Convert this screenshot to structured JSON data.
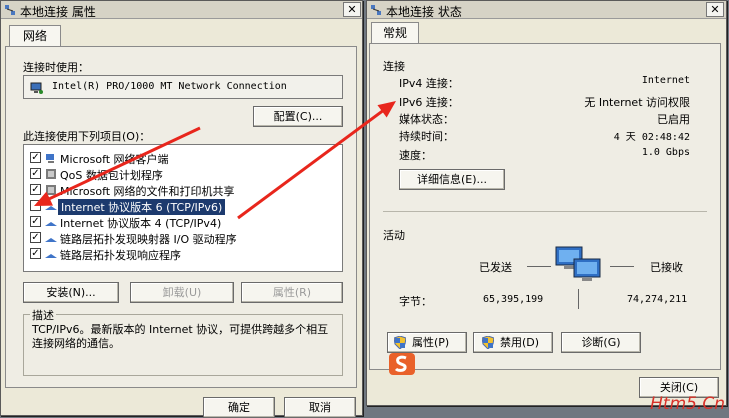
{
  "left_window": {
    "title": "本地连接 属性",
    "close_glyph": "✕",
    "tab": "网络",
    "connect_using_label": "连接时使用：",
    "adapter_name": "Intel(R) PRO/1000 MT Network Connection",
    "configure_button": "配置(C)...",
    "items_label": "此连接使用下列项目(O)：",
    "items": [
      {
        "label": "Microsoft 网络客户端",
        "checked": true
      },
      {
        "label": "QoS 数据包计划程序",
        "checked": true
      },
      {
        "label": "Microsoft 网络的文件和打印机共享",
        "checked": true
      },
      {
        "label": "Internet 协议版本 6 (TCP/IPv6)",
        "checked": false
      },
      {
        "label": "Internet 协议版本 4 (TCP/IPv4)",
        "checked": true
      },
      {
        "label": "链路层拓扑发现映射器 I/O 驱动程序",
        "checked": true
      },
      {
        "label": "链路层拓扑发现响应程序",
        "checked": true
      }
    ],
    "check_glyph": "✓",
    "install_button": "安装(N)...",
    "uninstall_button": "卸载(U)",
    "properties_button": "属性(R)",
    "description_label": "描述",
    "description_text": "TCP/IPv6。最新版本的 Internet 协议，可提供跨越多个相互连接网络的通信。",
    "ok_button": "确定",
    "cancel_button": "取消"
  },
  "right_window": {
    "title": "本地连接 状态",
    "close_glyph": "✕",
    "tab": "常规",
    "connection_label": "连接",
    "rows": [
      {
        "key": "IPv4 连接：",
        "value": "Internet"
      },
      {
        "key": "IPv6 连接：",
        "value": "无 Internet 访问权限"
      },
      {
        "key": "媒体状态：",
        "value": "已启用"
      },
      {
        "key": "持续时间：",
        "value": "4 天 02:48:42"
      },
      {
        "key": "速度：",
        "value": "1.0 Gbps"
      }
    ],
    "details_button": "详细信息(E)...",
    "activity_label": "活动",
    "sent_label": "已发送",
    "received_label": "已接收",
    "bytes_label": "字节：",
    "bytes_sent": "65,395,199",
    "bytes_received": "74,274,211",
    "properties_button": "属性(P)",
    "disable_button": "禁用(D)",
    "diagnose_button": "诊断(G)",
    "close_button": "关闭(C)"
  },
  "watermark": "Htm5.Cn",
  "colors": {
    "arrow": "#e8261c",
    "selection": "#1c3a6e",
    "watermark": "#d8322a"
  }
}
